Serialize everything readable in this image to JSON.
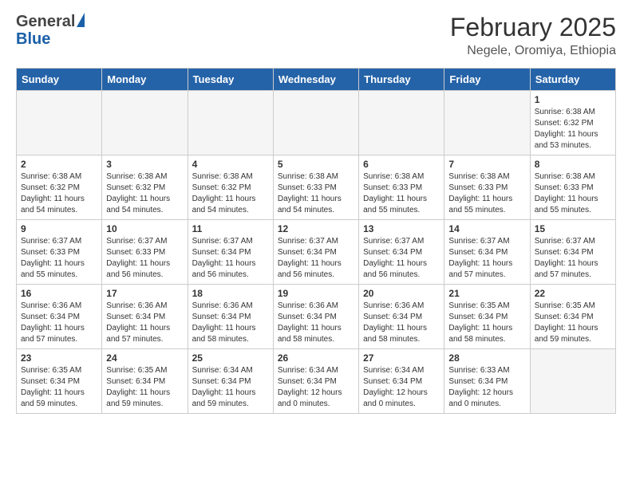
{
  "header": {
    "logo_general": "General",
    "logo_blue": "Blue",
    "month_title": "February 2025",
    "location": "Negele, Oromiya, Ethiopia"
  },
  "weekdays": [
    "Sunday",
    "Monday",
    "Tuesday",
    "Wednesday",
    "Thursday",
    "Friday",
    "Saturday"
  ],
  "weeks": [
    [
      {
        "day": "",
        "info": "",
        "empty": true
      },
      {
        "day": "",
        "info": "",
        "empty": true
      },
      {
        "day": "",
        "info": "",
        "empty": true
      },
      {
        "day": "",
        "info": "",
        "empty": true
      },
      {
        "day": "",
        "info": "",
        "empty": true
      },
      {
        "day": "",
        "info": "",
        "empty": true
      },
      {
        "day": "1",
        "info": "Sunrise: 6:38 AM\nSunset: 6:32 PM\nDaylight: 11 hours\nand 53 minutes.",
        "empty": false
      }
    ],
    [
      {
        "day": "2",
        "info": "Sunrise: 6:38 AM\nSunset: 6:32 PM\nDaylight: 11 hours\nand 54 minutes.",
        "empty": false
      },
      {
        "day": "3",
        "info": "Sunrise: 6:38 AM\nSunset: 6:32 PM\nDaylight: 11 hours\nand 54 minutes.",
        "empty": false
      },
      {
        "day": "4",
        "info": "Sunrise: 6:38 AM\nSunset: 6:32 PM\nDaylight: 11 hours\nand 54 minutes.",
        "empty": false
      },
      {
        "day": "5",
        "info": "Sunrise: 6:38 AM\nSunset: 6:33 PM\nDaylight: 11 hours\nand 54 minutes.",
        "empty": false
      },
      {
        "day": "6",
        "info": "Sunrise: 6:38 AM\nSunset: 6:33 PM\nDaylight: 11 hours\nand 55 minutes.",
        "empty": false
      },
      {
        "day": "7",
        "info": "Sunrise: 6:38 AM\nSunset: 6:33 PM\nDaylight: 11 hours\nand 55 minutes.",
        "empty": false
      },
      {
        "day": "8",
        "info": "Sunrise: 6:38 AM\nSunset: 6:33 PM\nDaylight: 11 hours\nand 55 minutes.",
        "empty": false
      }
    ],
    [
      {
        "day": "9",
        "info": "Sunrise: 6:37 AM\nSunset: 6:33 PM\nDaylight: 11 hours\nand 55 minutes.",
        "empty": false
      },
      {
        "day": "10",
        "info": "Sunrise: 6:37 AM\nSunset: 6:33 PM\nDaylight: 11 hours\nand 56 minutes.",
        "empty": false
      },
      {
        "day": "11",
        "info": "Sunrise: 6:37 AM\nSunset: 6:34 PM\nDaylight: 11 hours\nand 56 minutes.",
        "empty": false
      },
      {
        "day": "12",
        "info": "Sunrise: 6:37 AM\nSunset: 6:34 PM\nDaylight: 11 hours\nand 56 minutes.",
        "empty": false
      },
      {
        "day": "13",
        "info": "Sunrise: 6:37 AM\nSunset: 6:34 PM\nDaylight: 11 hours\nand 56 minutes.",
        "empty": false
      },
      {
        "day": "14",
        "info": "Sunrise: 6:37 AM\nSunset: 6:34 PM\nDaylight: 11 hours\nand 57 minutes.",
        "empty": false
      },
      {
        "day": "15",
        "info": "Sunrise: 6:37 AM\nSunset: 6:34 PM\nDaylight: 11 hours\nand 57 minutes.",
        "empty": false
      }
    ],
    [
      {
        "day": "16",
        "info": "Sunrise: 6:36 AM\nSunset: 6:34 PM\nDaylight: 11 hours\nand 57 minutes.",
        "empty": false
      },
      {
        "day": "17",
        "info": "Sunrise: 6:36 AM\nSunset: 6:34 PM\nDaylight: 11 hours\nand 57 minutes.",
        "empty": false
      },
      {
        "day": "18",
        "info": "Sunrise: 6:36 AM\nSunset: 6:34 PM\nDaylight: 11 hours\nand 58 minutes.",
        "empty": false
      },
      {
        "day": "19",
        "info": "Sunrise: 6:36 AM\nSunset: 6:34 PM\nDaylight: 11 hours\nand 58 minutes.",
        "empty": false
      },
      {
        "day": "20",
        "info": "Sunrise: 6:36 AM\nSunset: 6:34 PM\nDaylight: 11 hours\nand 58 minutes.",
        "empty": false
      },
      {
        "day": "21",
        "info": "Sunrise: 6:35 AM\nSunset: 6:34 PM\nDaylight: 11 hours\nand 58 minutes.",
        "empty": false
      },
      {
        "day": "22",
        "info": "Sunrise: 6:35 AM\nSunset: 6:34 PM\nDaylight: 11 hours\nand 59 minutes.",
        "empty": false
      }
    ],
    [
      {
        "day": "23",
        "info": "Sunrise: 6:35 AM\nSunset: 6:34 PM\nDaylight: 11 hours\nand 59 minutes.",
        "empty": false
      },
      {
        "day": "24",
        "info": "Sunrise: 6:35 AM\nSunset: 6:34 PM\nDaylight: 11 hours\nand 59 minutes.",
        "empty": false
      },
      {
        "day": "25",
        "info": "Sunrise: 6:34 AM\nSunset: 6:34 PM\nDaylight: 11 hours\nand 59 minutes.",
        "empty": false
      },
      {
        "day": "26",
        "info": "Sunrise: 6:34 AM\nSunset: 6:34 PM\nDaylight: 12 hours\nand 0 minutes.",
        "empty": false
      },
      {
        "day": "27",
        "info": "Sunrise: 6:34 AM\nSunset: 6:34 PM\nDaylight: 12 hours\nand 0 minutes.",
        "empty": false
      },
      {
        "day": "28",
        "info": "Sunrise: 6:33 AM\nSunset: 6:34 PM\nDaylight: 12 hours\nand 0 minutes.",
        "empty": false
      },
      {
        "day": "",
        "info": "",
        "empty": true
      }
    ]
  ]
}
